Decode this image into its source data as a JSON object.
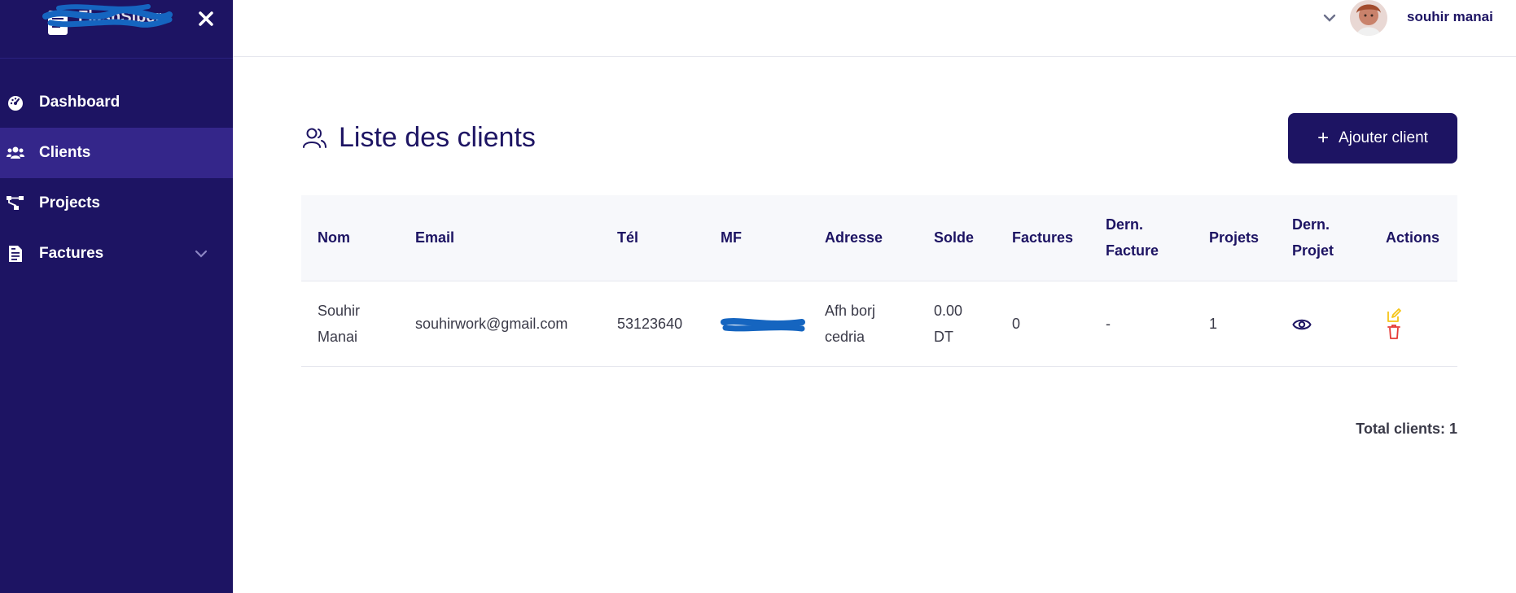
{
  "brand": {
    "name": "FlashSiber"
  },
  "sidebar": {
    "items": [
      {
        "label": "Dashboard",
        "icon": "dashboard-icon",
        "active": false
      },
      {
        "label": "Clients",
        "icon": "users-icon",
        "active": true
      },
      {
        "label": "Projects",
        "icon": "project-diagram-icon",
        "active": false
      },
      {
        "label": "Factures",
        "icon": "invoice-icon",
        "active": false,
        "has_submenu": true
      }
    ]
  },
  "topbar": {
    "user_name": "souhir manai"
  },
  "main": {
    "title": "Liste des clients",
    "add_button_label": "Ajouter client",
    "table": {
      "headers": {
        "nom": "Nom",
        "email": "Email",
        "tel": "Tél",
        "mf": "MF",
        "adresse": "Adresse",
        "solde": "Solde",
        "factures": "Factures",
        "dern_facture_1": "Dern.",
        "dern_facture_2": "Facture",
        "projets": "Projets",
        "dern_projet_1": "Dern.",
        "dern_projet_2": "Projet",
        "actions": "Actions"
      },
      "rows": [
        {
          "nom_1": "Souhir",
          "nom_2": "Manai",
          "email": "souhirwork@gmail.com",
          "tel": "53123640",
          "adresse_1": "Afh borj",
          "adresse_2": "cedria",
          "solde_1": "0.00",
          "solde_2": "DT",
          "factures": "0",
          "dern_facture": "-",
          "projets": "1"
        }
      ]
    },
    "total_label": "Total clients: 1"
  },
  "colors": {
    "sidebar_bg": "#1d1463",
    "sidebar_active": "#34268a",
    "primary": "#1d1463",
    "edit": "#f5c518",
    "delete": "#e53935",
    "redaction": "#1565c0"
  }
}
